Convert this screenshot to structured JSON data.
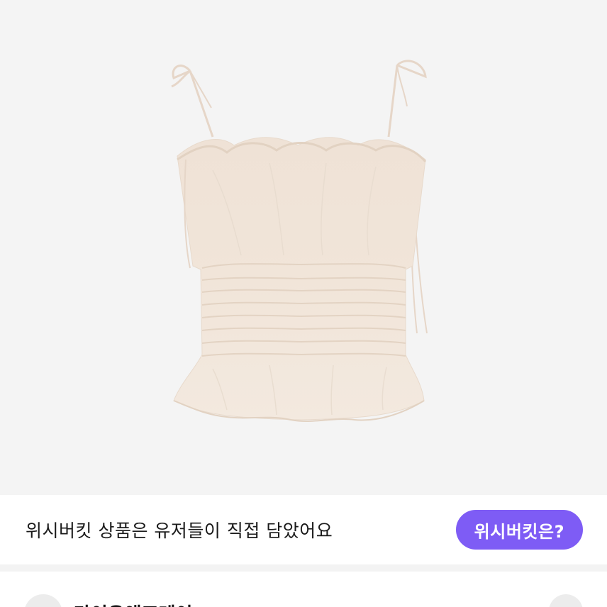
{
  "banner": {
    "text": "위시버킷 상품은 유저들이 직접 담았어요",
    "button_label": "위시버킷은?"
  },
  "seller": {
    "name": "라이유앤프레이",
    "chevron": "›"
  },
  "colors": {
    "accent": "#7e5cf5",
    "image_bg": "#f4f4f4"
  }
}
